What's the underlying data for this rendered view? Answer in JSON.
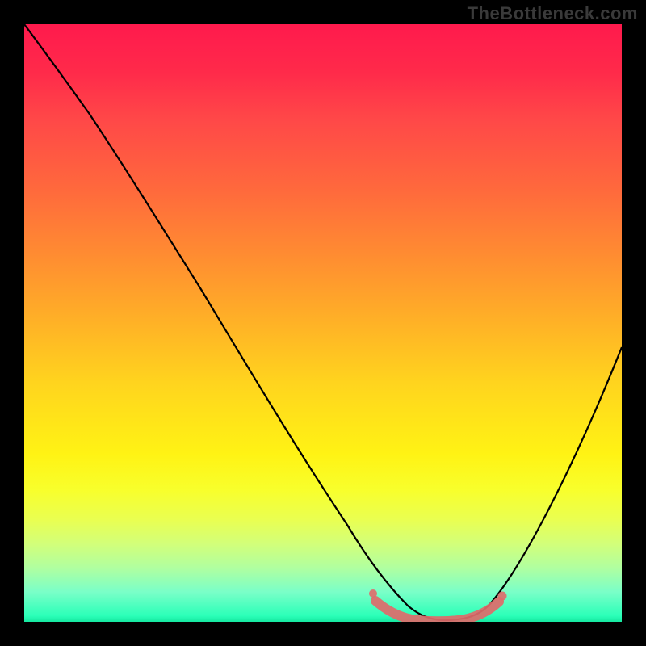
{
  "watermark": "TheBottleneck.com",
  "chart_data": {
    "type": "line",
    "title": "",
    "xlabel": "",
    "ylabel": "",
    "xlim": [
      0,
      100
    ],
    "ylim": [
      0,
      100
    ],
    "series": [
      {
        "name": "bottleneck-curve",
        "x": [
          0,
          5,
          10,
          15,
          20,
          25,
          30,
          35,
          40,
          45,
          50,
          55,
          60,
          63,
          66,
          70,
          74,
          78,
          82,
          86,
          90,
          94,
          100
        ],
        "values": [
          100,
          95,
          89,
          83,
          76,
          69,
          62,
          55,
          47,
          39,
          31,
          22,
          13,
          7,
          3,
          1,
          1,
          2,
          6,
          13,
          22,
          32,
          49
        ]
      }
    ],
    "highlight_region": {
      "name": "optimal-zone",
      "x": [
        58,
        60,
        63,
        66,
        69,
        72,
        75,
        78,
        80
      ],
      "values": [
        6,
        3,
        2,
        1,
        1,
        1,
        2,
        3,
        5
      ],
      "color": "#e06a6a"
    },
    "gradient_bands": [
      {
        "pos": 0,
        "color": "#ff1a4d"
      },
      {
        "pos": 50,
        "color": "#ffd41e"
      },
      {
        "pos": 80,
        "color": "#f8ff2c"
      },
      {
        "pos": 100,
        "color": "#15e8a0"
      }
    ]
  }
}
